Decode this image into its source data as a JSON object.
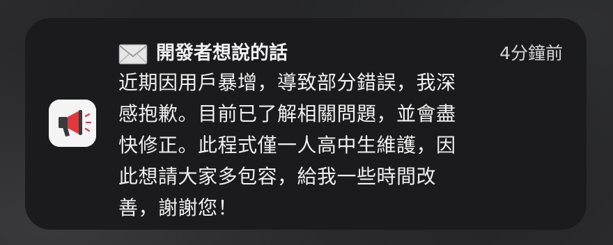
{
  "notification": {
    "app_icon": "megaphone-icon",
    "header_icon": "envelope-icon",
    "title": "開發者想說的話",
    "timestamp": "4分鐘前",
    "message_lines": [
      "近期因用戶暴增，導致部分錯誤，我深",
      "感抱歉。目前已了解相關問題，並會盡",
      "快修正。此程式僅一人高中生維護，因",
      "此想請大家多包容，給我一些時間改",
      "善，謝謝您！"
    ]
  },
  "colors": {
    "card_background": "#1b1b1d",
    "text_primary": "#f0f0f0",
    "text_secondary": "#d6d6d6",
    "icon_background": "#f4f4f4",
    "megaphone_red": "#e0383e"
  }
}
